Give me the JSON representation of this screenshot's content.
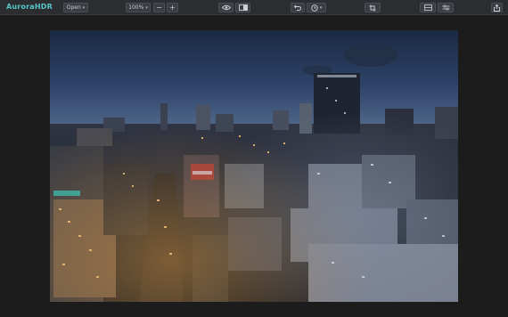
{
  "app": {
    "logo_text": "AuroraHDR"
  },
  "toolbar": {
    "open_label": "Open",
    "zoom_value": "100%",
    "zoom_out_symbol": "−",
    "zoom_in_symbol": "+",
    "icons": [
      "eye-icon",
      "compare-icon",
      "undo-icon",
      "history-icon",
      "crop-icon",
      "layers-icon",
      "adjustments-icon",
      "share-icon"
    ]
  },
  "colors": {
    "toolbar_bg": "#2b2d31",
    "app_bg": "#1c1c1d",
    "accent": "#56c6c7"
  },
  "photo": {
    "subject": "night-city-skyline"
  }
}
